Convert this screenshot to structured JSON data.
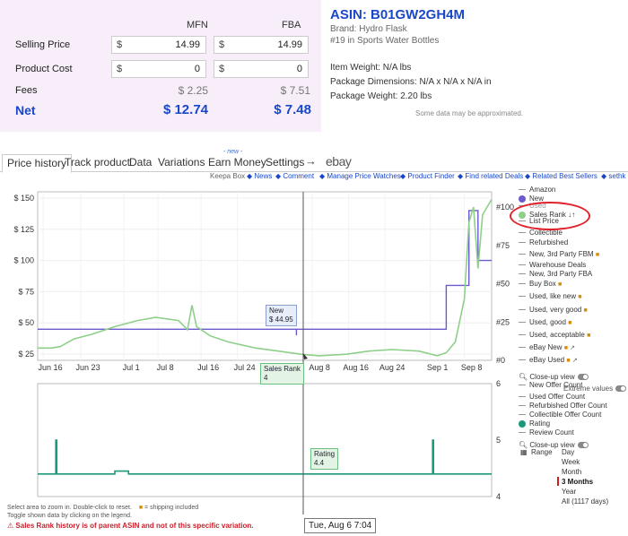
{
  "calculator": {
    "col_mfn": "MFN",
    "col_fba": "FBA",
    "selling_price_label": "Selling Price",
    "product_cost_label": "Product Cost",
    "fees_label": "Fees",
    "net_label": "Net",
    "currency": "$",
    "selling_price_mfn": "14.99",
    "selling_price_fba": "14.99",
    "product_cost_mfn": "0",
    "product_cost_fba": "0",
    "fees_mfn": "$ 2.25",
    "fees_fba": "$ 7.51",
    "net_mfn": "$ 12.74",
    "net_fba": "$ 7.48"
  },
  "product": {
    "asin": "ASIN: B01GW2GH4M",
    "brand": "Brand: Hydro Flask",
    "rank": "#19 in Sports Water Bottles",
    "weight": "Item Weight: N/A lbs",
    "dimensions": "Package Dimensions: N/A x N/A x N/A in",
    "package_weight": "Package Weight: 2.20 lbs",
    "approx_note": "Some data may be approximated."
  },
  "tabs": {
    "price_history": "Price history",
    "track_product": "Track product",
    "data": "Data",
    "variations": "Variations",
    "earn_money": "Earn Money",
    "new_tag": "- new -",
    "settings": "Settings",
    "arrow": "→",
    "ebay": "ebay"
  },
  "links": {
    "keepa_box": "Keepa Box",
    "news": "News",
    "comment": "Comment",
    "manage_watches": "Manage Price Watches",
    "finder": "Product Finder",
    "related_deals": "Find related Deals",
    "best_sellers": "Related Best Sellers",
    "user": "sethk"
  },
  "chart_data": [
    {
      "type": "line",
      "x_ticks": [
        "Jun 16",
        "Jun 23",
        "Jul 1",
        "Jul 8",
        "Jul 16",
        "Jul 24",
        "Aug 8",
        "Aug 16",
        "Aug 24",
        "Sep 1",
        "Sep 8"
      ],
      "y_left_ticks": [
        "$ 150",
        "$ 125",
        "$ 100",
        "$ 75",
        "$ 50",
        "$ 25"
      ],
      "y_right_ticks": [
        "#100",
        "#75",
        "#50",
        "#25",
        "#0"
      ],
      "ylim_left": [
        20,
        155
      ],
      "ylim_right": [
        0,
        110
      ],
      "series": [
        {
          "name": "New",
          "color": "#6a5acd",
          "axis": "left",
          "points": [
            [
              0,
              44.95
            ],
            [
              0.57,
              44.95
            ],
            [
              0.57,
              40
            ],
            [
              0.57,
              44.95
            ],
            [
              0.9,
              44.95
            ],
            [
              0.9,
              80
            ],
            [
              0.95,
              80
            ],
            [
              0.95,
              140
            ],
            [
              0.97,
              140
            ],
            [
              0.97,
              100
            ],
            [
              1.0,
              100
            ]
          ]
        },
        {
          "name": "Sales Rank",
          "color": "#8fcf8a",
          "axis": "right",
          "points": [
            [
              0,
              8
            ],
            [
              0.03,
              8
            ],
            [
              0.05,
              9
            ],
            [
              0.08,
              14
            ],
            [
              0.12,
              17
            ],
            [
              0.17,
              22
            ],
            [
              0.22,
              26
            ],
            [
              0.26,
              28
            ],
            [
              0.31,
              26
            ],
            [
              0.33,
              20
            ],
            [
              0.34,
              36
            ],
            [
              0.35,
              22
            ],
            [
              0.38,
              16
            ],
            [
              0.42,
              12
            ],
            [
              0.48,
              8
            ],
            [
              0.53,
              6
            ],
            [
              0.58,
              4
            ],
            [
              0.62,
              3
            ],
            [
              0.68,
              4
            ],
            [
              0.73,
              6
            ],
            [
              0.78,
              7
            ],
            [
              0.84,
              6
            ],
            [
              0.88,
              3
            ],
            [
              0.9,
              5
            ],
            [
              0.92,
              12
            ],
            [
              0.94,
              40
            ],
            [
              0.95,
              90
            ],
            [
              0.96,
              100
            ],
            [
              0.97,
              60
            ],
            [
              0.98,
              95
            ],
            [
              1.0,
              105
            ]
          ]
        }
      ]
    },
    {
      "type": "line",
      "y_right_ticks": [
        "6",
        "5",
        "4"
      ],
      "ylim": [
        4,
        6
      ],
      "series": [
        {
          "name": "Rating",
          "color": "#1a9a7a",
          "points": [
            [
              0,
              4.4
            ],
            [
              0.04,
              4.4
            ],
            [
              0.04,
              5.0
            ],
            [
              0.042,
              5.0
            ],
            [
              0.042,
              4.4
            ],
            [
              0.17,
              4.4
            ],
            [
              0.17,
              4.45
            ],
            [
              0.2,
              4.45
            ],
            [
              0.2,
              4.4
            ],
            [
              0.87,
              4.4
            ],
            [
              0.87,
              5.0
            ],
            [
              0.872,
              5.0
            ],
            [
              0.872,
              4.4
            ],
            [
              1.0,
              4.4
            ]
          ]
        }
      ]
    }
  ],
  "bubbles": {
    "new_label": "New",
    "new_value": "$ 44.95",
    "rank_label": "Sales Rank",
    "rank_value": "4",
    "rating_label": "Rating",
    "rating_value": "4.4"
  },
  "legend": {
    "amazon": "Amazon",
    "new": "New",
    "used": "Used",
    "sales_rank": "Sales Rank",
    "list_price": "List Price",
    "collectible": "Collectible",
    "refurbished": "Refurbished",
    "new_3p_fbm": "New, 3rd Party FBM",
    "warehouse": "Warehouse Deals",
    "new_3p_fba": "New, 3rd Party FBA",
    "buy_box": "Buy Box",
    "used_like_new": "Used, like new",
    "used_very_good": "Used, very good",
    "used_good": "Used, good",
    "used_acceptable": "Used, acceptable",
    "ebay_new": "eBay New",
    "ebay_used": "eBay Used",
    "closeup": "Close-up view",
    "new_offer_count": "New Offer Count",
    "extreme_values": "Extreme values",
    "used_offer_count": "Used Offer Count",
    "refurbished_offer_count": "Refurbished Offer Count",
    "collectible_offer_count": "Collectible Offer Count",
    "rating": "Rating",
    "review_count": "Review Count",
    "closeup2": "Close-up view",
    "range_label": "Range",
    "day": "Day",
    "week": "Week",
    "month": "Month",
    "three_months": "3 Months",
    "year": "Year",
    "all": "All (1117 days)",
    "colors": {
      "new": "#6a5acd",
      "sales_rank": "#8fcf8a",
      "rating": "#1a9a7a"
    }
  },
  "footer": {
    "hint1": "Select area to zoom in. Double-click to reset.",
    "shipping": "= shipping included",
    "hint2": "Toggle shown data by clicking on the legend.",
    "warning": "Sales Rank history is of parent ASIN and not of this specific variation.",
    "tooltip": "Tue, Aug 6 7:04"
  }
}
